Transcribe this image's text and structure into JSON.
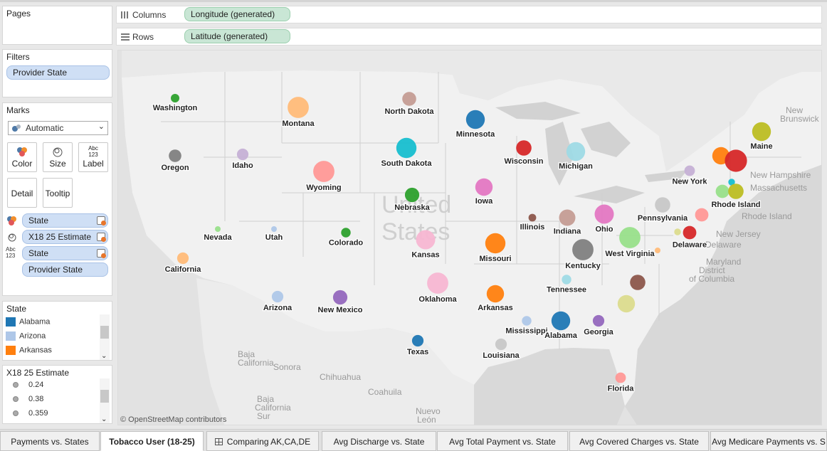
{
  "pages": {
    "title": "Pages"
  },
  "filters": {
    "title": "Filters",
    "pill": "Provider State"
  },
  "marks": {
    "title": "Marks",
    "mark_type": "Automatic",
    "cards": {
      "color": "Color",
      "size": "Size",
      "label": "Label",
      "detail": "Detail",
      "tooltip": "Tooltip"
    },
    "label_icon_text": "Abc 123",
    "fields": [
      "State",
      "X18 25 Estimate",
      "State",
      "Provider State"
    ]
  },
  "state_legend": {
    "title": "State",
    "items": [
      {
        "name": "Alabama",
        "color": "#1f77b4"
      },
      {
        "name": "Arizona",
        "color": "#aec7e8"
      },
      {
        "name": "Arkansas",
        "color": "#ff7f0e"
      }
    ]
  },
  "size_legend": {
    "title": "X18 25 Estimate",
    "items": [
      "0.24",
      "0.38",
      "0.359"
    ]
  },
  "shelves": {
    "columns_label": "Columns",
    "columns_pill": "Longitude (generated)",
    "rows_label": "Rows",
    "rows_pill": "Latitude (generated)"
  },
  "map": {
    "attribution": "© OpenStreetMap contributors",
    "watermark": [
      "United",
      "States"
    ],
    "basemap_labels": [
      "Baja California",
      "Sonora",
      "Chihuahua",
      "Coahuila",
      "Nuevo León",
      "Baja California Sur",
      "New Brunswick",
      "New Hampshire",
      "Massachusetts",
      "Rhode Island",
      "New Jersey",
      "Delaware",
      "Maryland",
      "District of Columbia"
    ],
    "marks": [
      {
        "state": "Washington",
        "color": "#2ca02c",
        "size": 0.24
      },
      {
        "state": "Montana",
        "color": "#ffbb78",
        "size": 0.5
      },
      {
        "state": "North Dakota",
        "color": "#c49c94",
        "size": 0.35
      },
      {
        "state": "Minnesota",
        "color": "#1f77b4",
        "size": 0.45
      },
      {
        "state": "Oregon",
        "color": "#7f7f7f",
        "size": 0.32
      },
      {
        "state": "Idaho",
        "color": "#c5b0d5",
        "size": 0.3
      },
      {
        "state": "South Dakota",
        "color": "#17becf",
        "size": 0.48
      },
      {
        "state": "Wisconsin",
        "color": "#d62728",
        "size": 0.38
      },
      {
        "state": "Michigan",
        "color": "#9edae5",
        "size": 0.45
      },
      {
        "state": "Maine",
        "color": "#bcbd22",
        "size": 0.45
      },
      {
        "state": "Wyoming",
        "color": "#ff9896",
        "size": 0.5
      },
      {
        "state": "Nebraska",
        "color": "#2ca02c",
        "size": 0.36
      },
      {
        "state": "Iowa",
        "color": "#e377c2",
        "size": 0.42
      },
      {
        "state": "New York",
        "color": "#c5b0d5",
        "size": 0.28
      },
      {
        "state": "Rhode Island",
        "color": "#bcbd22",
        "size": 0.38
      },
      {
        "state": "Nevada",
        "color": "#98df8a",
        "size": 0.18
      },
      {
        "state": "Utah",
        "color": "#aec7e8",
        "size": 0.18
      },
      {
        "state": "Colorado",
        "color": "#2ca02c",
        "size": 0.26
      },
      {
        "state": "Kansas",
        "color": "#f7b6d2",
        "size": 0.46
      },
      {
        "state": "Illinois",
        "color": "#8c564b",
        "size": 0.22
      },
      {
        "state": "Indiana",
        "color": "#c49c94",
        "size": 0.4
      },
      {
        "state": "Ohio",
        "color": "#e377c2",
        "size": 0.46
      },
      {
        "state": "Pennsylvania",
        "color": "#c7c7c7",
        "size": 0.38
      },
      {
        "state": "West Virginia",
        "color": "#98df8a",
        "size": 0.5
      },
      {
        "state": "Delaware",
        "color": "#d62728",
        "size": 0.34
      },
      {
        "state": "California",
        "color": "#ffbb78",
        "size": 0.3
      },
      {
        "state": "Missouri",
        "color": "#ff7f0e",
        "size": 0.48
      },
      {
        "state": "Kentucky",
        "color": "#7f7f7f",
        "size": 0.5
      },
      {
        "state": "Tennessee",
        "color": "#9edae5",
        "size": 0.26
      },
      {
        "state": "Oklahoma",
        "color": "#f7b6d2",
        "size": 0.5
      },
      {
        "state": "Arizona",
        "color": "#aec7e8",
        "size": 0.3
      },
      {
        "state": "New Mexico",
        "color": "#9467bd",
        "size": 0.36
      },
      {
        "state": "Arkansas",
        "color": "#ff7f0e",
        "size": 0.42
      },
      {
        "state": "Mississippi",
        "color": "#aec7e8",
        "size": 0.26
      },
      {
        "state": "Alabama",
        "color": "#1f77b4",
        "size": 0.45
      },
      {
        "state": "Georgia",
        "color": "#9467bd",
        "size": 0.3
      },
      {
        "state": "Texas",
        "color": "#1f77b4",
        "size": 0.3
      },
      {
        "state": "Louisiana",
        "color": "#c7c7c7",
        "size": 0.3
      },
      {
        "state": "Florida",
        "color": "#ff9896",
        "size": 0.28
      }
    ],
    "unlabeled_marks": [
      {
        "color": "#ff7f0e",
        "size": 0.42
      },
      {
        "color": "#d62728",
        "size": 0.52
      },
      {
        "color": "#17becf",
        "size": 0.2
      },
      {
        "color": "#98df8a",
        "size": 0.34
      },
      {
        "color": "#ff9896",
        "size": 0.34
      },
      {
        "color": "#dbdb8d",
        "size": 0.2
      },
      {
        "color": "#ffbb78",
        "size": 0.18
      },
      {
        "color": "#8c564b",
        "size": 0.38
      },
      {
        "color": "#dbdb8d",
        "size": 0.42
      }
    ]
  },
  "tabs": [
    "Payments vs. States",
    "Tobacco User (18-25)",
    "Comparing AK,CA,DE",
    "Avg Discharge vs. State",
    "Avg Total Payment vs. State",
    "Avg Covered Charges vs. State",
    "Avg Medicare Payments vs. S"
  ],
  "active_tab": "Tobacco User (18-25)"
}
